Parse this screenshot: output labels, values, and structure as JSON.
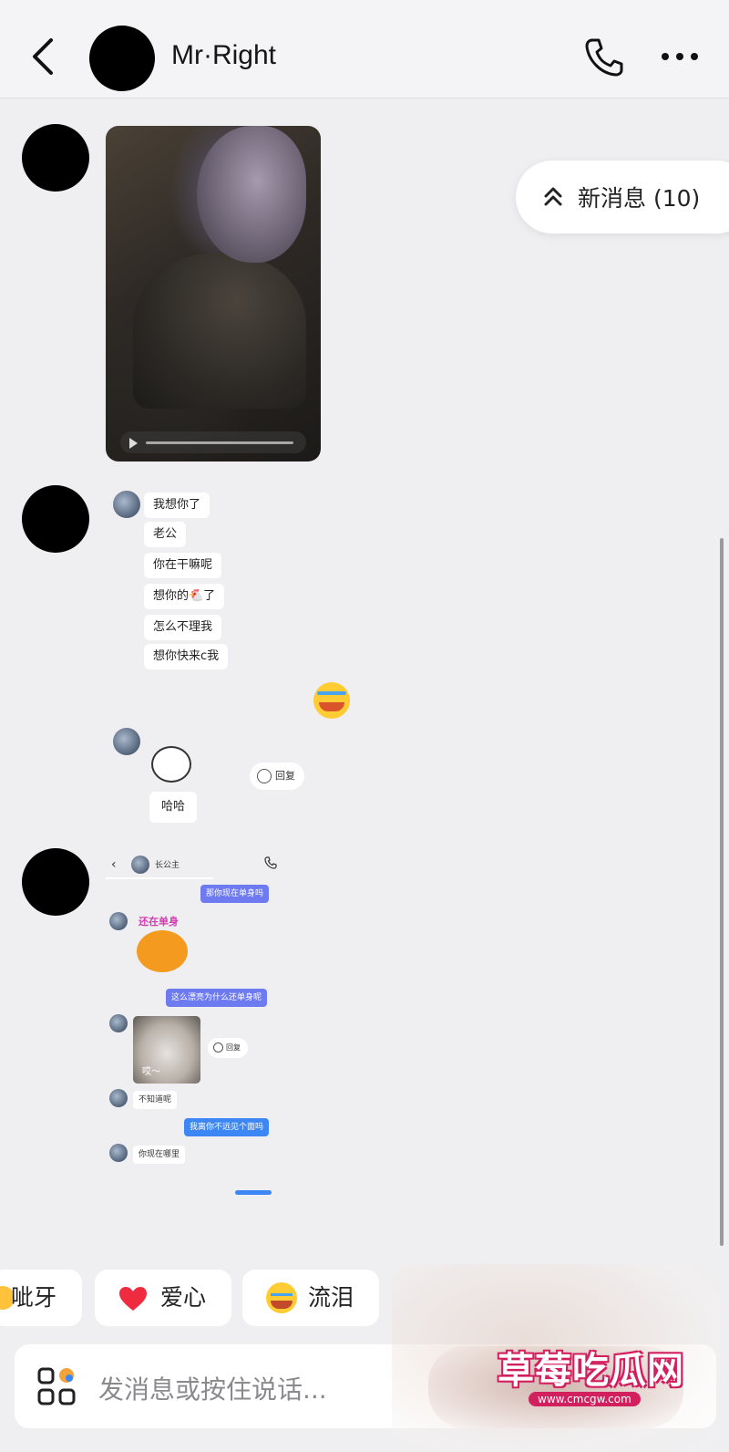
{
  "header": {
    "title": "Mr·Right",
    "back_icon": "chevron-left-icon",
    "call_icon": "phone-icon",
    "more_icon": "more-icon"
  },
  "new_messages": {
    "label": "新消息 (10)",
    "icon": "double-chevron-up-icon"
  },
  "screenshot1": {
    "messages": [
      "我想你了",
      "老公",
      "你在干嘛呢",
      "想你的🐔了",
      "怎么不理我",
      "想你快来c我"
    ],
    "sticker_caption": "哈哈",
    "reply_label": "回复"
  },
  "screenshot2": {
    "contact_name": "长公主",
    "msg_sent_1": "那你现在单身吗",
    "sticker_text": "还在单身",
    "msg_sent_2": "这么漂亮为什么还单身呢",
    "cat_caption": "哎～",
    "reply_label": "回复",
    "msg_recv_1": "不知道呢",
    "msg_sent_3": "我离你不远见个面吗",
    "msg_recv_2": "你现在哪里"
  },
  "reactions": [
    {
      "label": "呲牙",
      "icon": "grin-emoji-icon"
    },
    {
      "label": "爱心",
      "icon": "heart-icon"
    },
    {
      "label": "流泪",
      "icon": "crying-emoji-icon"
    }
  ],
  "input": {
    "placeholder": "发消息或按住说话...",
    "apps_icon": "apps-grid-icon"
  },
  "watermark": {
    "title": "草莓吃瓜网",
    "url": "www.cmcgw.com"
  },
  "colors": {
    "background": "#efeff1",
    "sent_bubble": "#3d87f5",
    "sent_bubble_alt": "#6d7af0",
    "watermark_pink": "#d21f5e"
  }
}
